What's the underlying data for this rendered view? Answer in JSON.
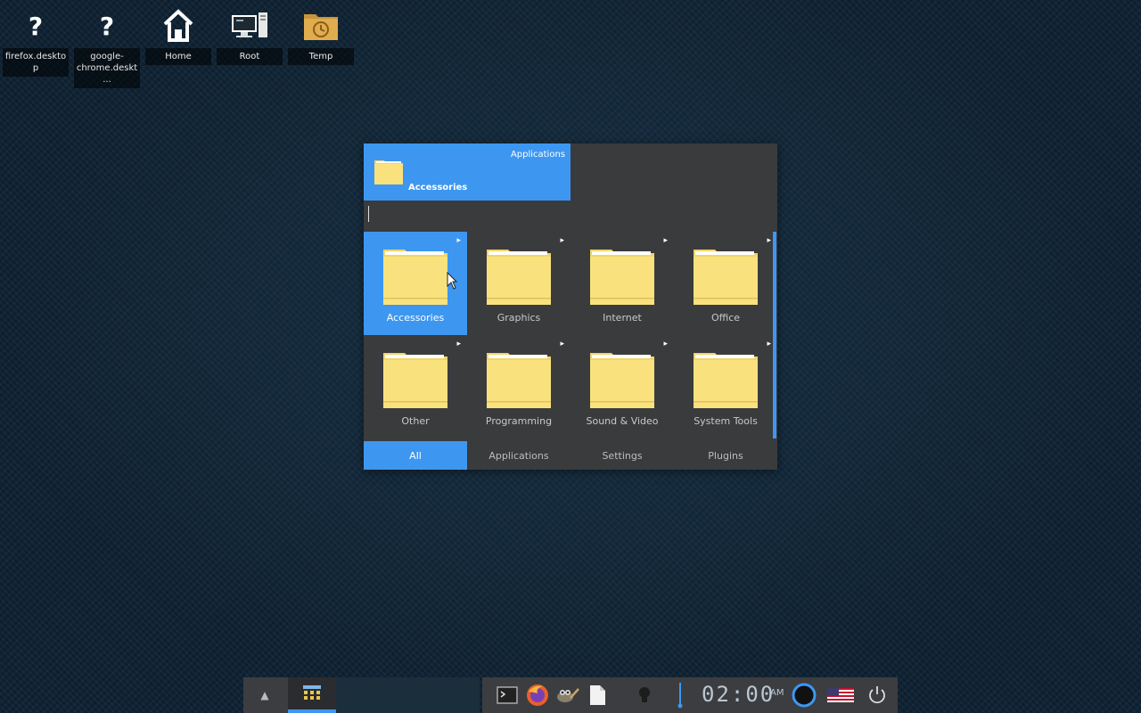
{
  "desktop": {
    "icons": [
      {
        "label": "firefox.desktop",
        "icon": "question-mark-icon"
      },
      {
        "label": "google-chrome.deskt...",
        "icon": "question-mark-icon"
      },
      {
        "label": "Home",
        "icon": "home-icon"
      },
      {
        "label": "Root",
        "icon": "computer-icon"
      },
      {
        "label": "Temp",
        "icon": "folder-clock-icon"
      }
    ]
  },
  "launcher": {
    "breadcrumb": {
      "parent": "Applications",
      "current": "Accessories"
    },
    "search": {
      "value": "",
      "placeholder": ""
    },
    "categories": [
      {
        "label": "Accessories",
        "selected": true
      },
      {
        "label": "Graphics",
        "selected": false
      },
      {
        "label": "Internet",
        "selected": false
      },
      {
        "label": "Office",
        "selected": false
      },
      {
        "label": "Other",
        "selected": false
      },
      {
        "label": "Programming",
        "selected": false
      },
      {
        "label": "Sound & Video",
        "selected": false
      },
      {
        "label": "System Tools",
        "selected": false
      }
    ],
    "tabs": [
      {
        "label": "All",
        "active": true
      },
      {
        "label": "Applications",
        "active": false
      },
      {
        "label": "Settings",
        "active": false
      },
      {
        "label": "Plugins",
        "active": false
      }
    ]
  },
  "taskbar": {
    "clock": {
      "time": "02:00",
      "ampm": "AM"
    },
    "tray_icons": [
      "terminal-icon",
      "firefox-icon",
      "gimp-icon",
      "text-file-icon",
      "lightbulb-icon",
      "volume-icon",
      "network-ring-icon",
      "us-flag-icon",
      "power-icon"
    ]
  },
  "colors": {
    "accent": "#3d97f0",
    "launcher_bg": "#3a3b3d",
    "folder": "#f9e27e"
  }
}
